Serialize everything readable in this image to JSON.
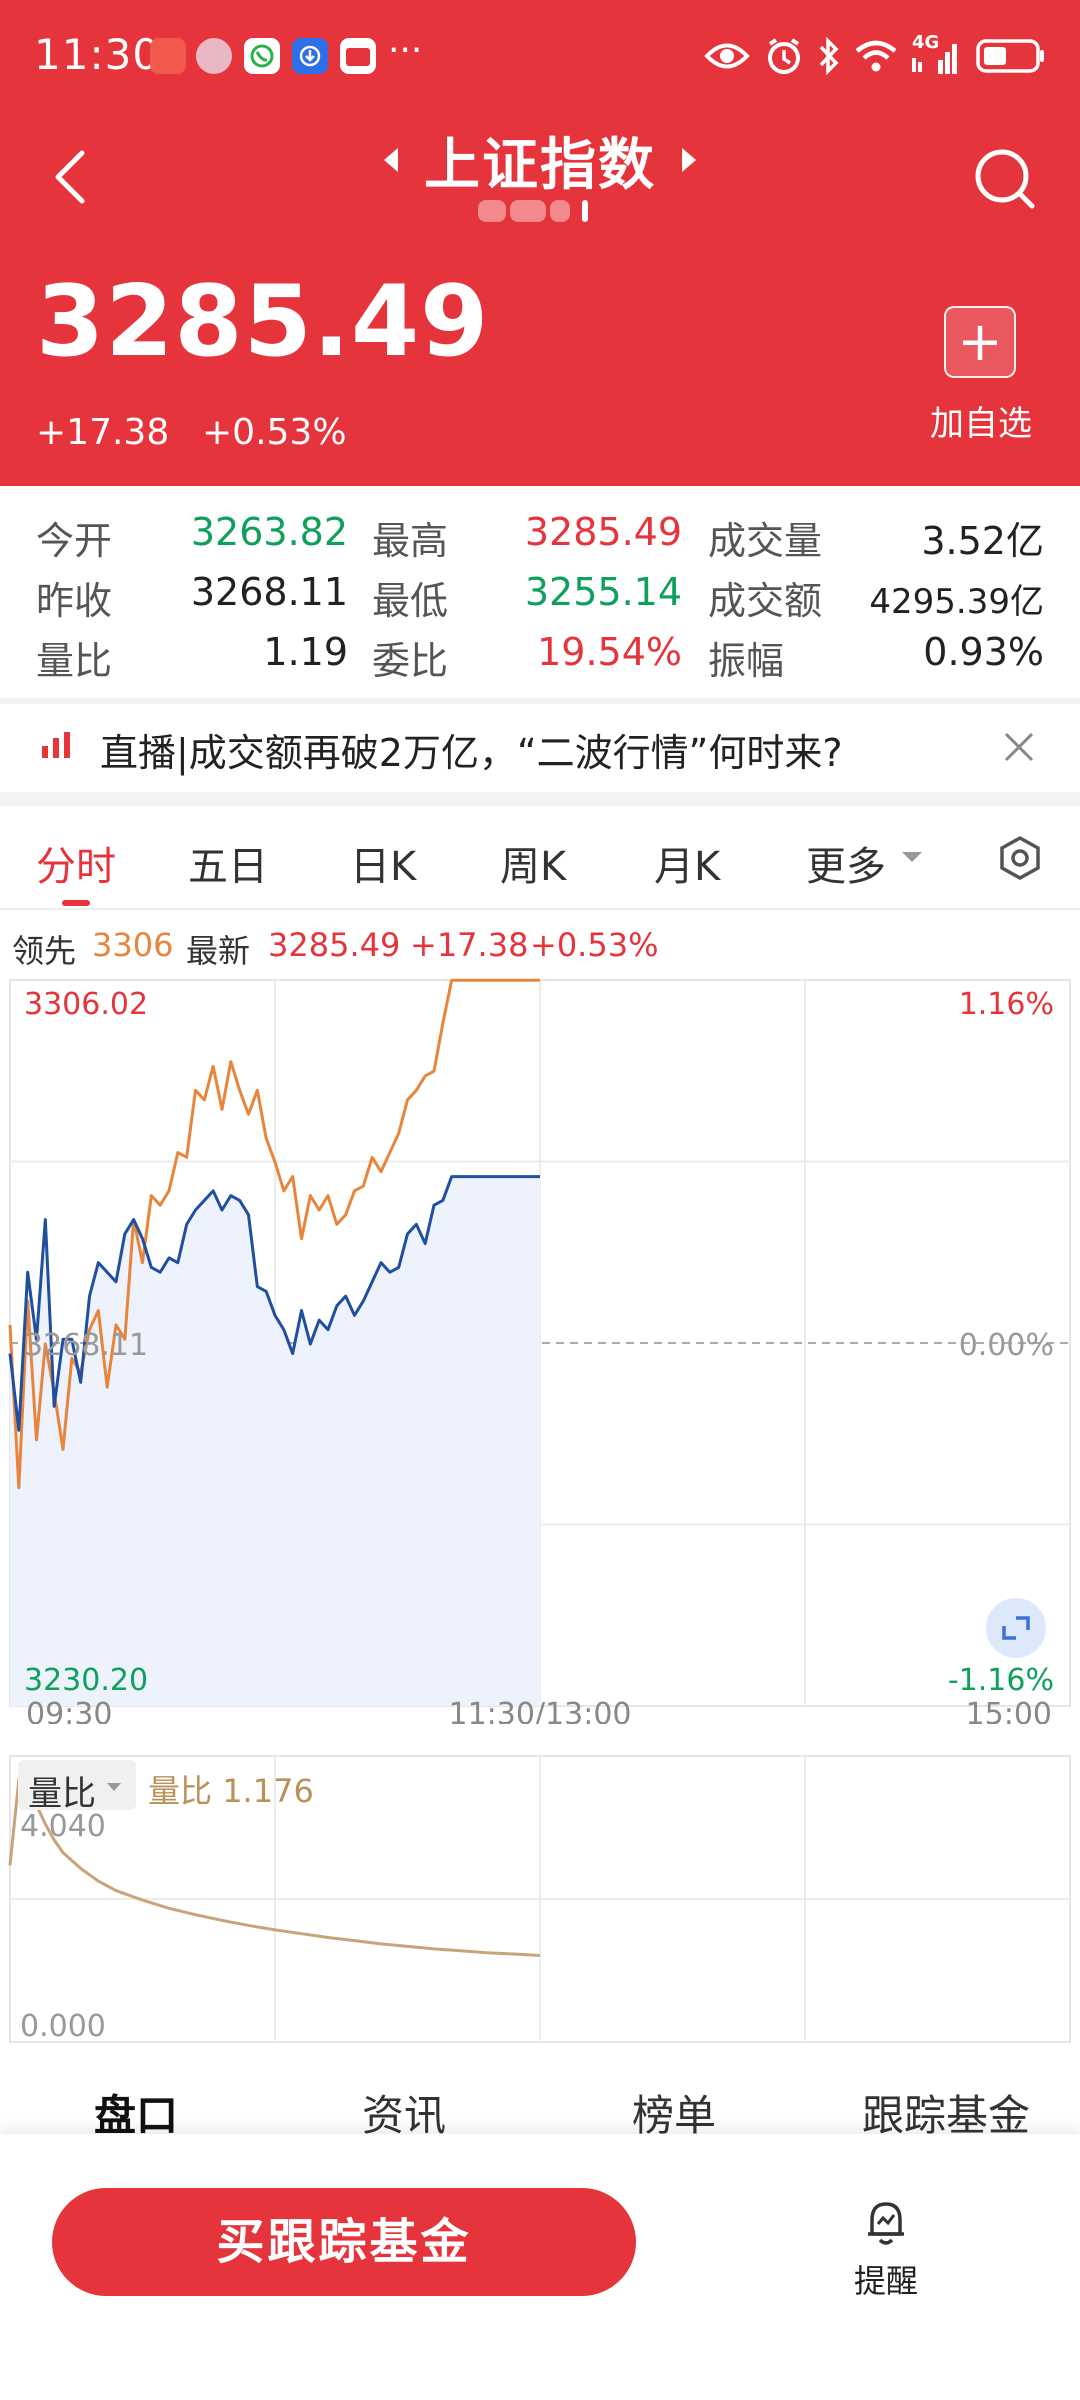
{
  "status_bar": {
    "time": "11:30",
    "more": "···",
    "icons": [
      "huawei-app-icon",
      "avatar-app-icon",
      "phone-app-icon",
      "download-app-icon",
      "shop-app-icon",
      "eye-icon",
      "alarm-icon",
      "bluetooth-icon",
      "wifi-icon",
      "signal-4g-icon",
      "battery-icon"
    ],
    "network": "4G"
  },
  "header": {
    "title": "上证指数",
    "price": "3285.49",
    "change": "+17.38",
    "change_pct": "+0.53%",
    "add_label": "加自选",
    "add_symbol": "+",
    "bg_color": "#e5343b"
  },
  "quote": {
    "rows": [
      [
        {
          "label": "今开",
          "value": "3263.82",
          "color": "green"
        },
        {
          "label": "最高",
          "value": "3285.49",
          "color": "red"
        },
        {
          "label": "成交量",
          "value": "3.52亿",
          "color": "black"
        }
      ],
      [
        {
          "label": "昨收",
          "value": "3268.11",
          "color": "black"
        },
        {
          "label": "最低",
          "value": "3255.14",
          "color": "green"
        },
        {
          "label": "成交额",
          "value": "4295.39亿",
          "color": "black"
        }
      ],
      [
        {
          "label": "量比",
          "value": "1.19",
          "color": "black"
        },
        {
          "label": "委比",
          "value": "19.54%",
          "color": "red"
        },
        {
          "label": "振幅",
          "value": "0.93%",
          "color": "black"
        }
      ]
    ]
  },
  "news": {
    "text": "直播|成交额再破2万亿，“二波行情”何时来?"
  },
  "tabs": {
    "items": [
      "分时",
      "五日",
      "日K",
      "周K",
      "月K",
      "更多"
    ],
    "active": 0
  },
  "legend": {
    "lead_label": "领先",
    "lead_value": "3306",
    "latest_label": "最新",
    "latest_value": "3285.49",
    "latest_change": "+17.38",
    "latest_pct": "+0.53%"
  },
  "chart_data": [
    {
      "type": "line",
      "title": "",
      "x_ticks": [
        "09:30",
        "11:30/13:00",
        "15:00"
      ],
      "y_left_ticks": [
        "3306.02",
        "3268.11",
        "3230.20"
      ],
      "y_right_ticks": [
        "1.16%",
        "0.00%",
        "-1.16%"
      ],
      "ylim": [
        3230.2,
        3306.02
      ],
      "reference": 3268.11,
      "colors": {
        "lead": "#e8853d",
        "latest": "#1f4f9e",
        "fill": "#eef2fd",
        "up": "#e5343b",
        "down": "#0fa05c"
      },
      "series": [
        {
          "name": "领先",
          "time_index": [
            0,
            2,
            4,
            6,
            8,
            10,
            12,
            14,
            16,
            18,
            20,
            22,
            24,
            26,
            28,
            30,
            32,
            34,
            36,
            38,
            40,
            42,
            44,
            46,
            48,
            50,
            52,
            54,
            56,
            58,
            60,
            62,
            64,
            66,
            68,
            70,
            72,
            74,
            76,
            78,
            80,
            82,
            84,
            86,
            88,
            90,
            92,
            94,
            96,
            98,
            100,
            102,
            104,
            106,
            108,
            110,
            112,
            114,
            116,
            118,
            120
          ],
          "values": [
            3270.0,
            3253.0,
            3272.5,
            3258.0,
            3268.0,
            3263.0,
            3257.0,
            3266.5,
            3265.0,
            3269.5,
            3271.5,
            3263.5,
            3270.0,
            3268.5,
            3281.0,
            3276.5,
            3283.5,
            3282.5,
            3284.0,
            3288.0,
            3287.5,
            3294.5,
            3293.5,
            3297.0,
            3292.5,
            3297.5,
            3294.5,
            3292.0,
            3294.5,
            3289.5,
            3287.0,
            3284.0,
            3285.5,
            3279.0,
            3283.5,
            3282.0,
            3283.5,
            3280.5,
            3281.5,
            3284.0,
            3284.5,
            3287.5,
            3286.0,
            3288.0,
            3290.0,
            3293.5,
            3294.5,
            3296.0,
            3296.5,
            3301.5,
            3306.0,
            3306.0,
            3306.0,
            3306.0,
            3306.0,
            3306.0,
            3306.0,
            3306.0,
            3306.0,
            3306.0,
            3306.0
          ]
        },
        {
          "name": "最新",
          "time_index": [
            0,
            2,
            4,
            6,
            8,
            10,
            12,
            14,
            16,
            18,
            20,
            22,
            24,
            26,
            28,
            30,
            32,
            34,
            36,
            38,
            40,
            42,
            44,
            46,
            48,
            50,
            52,
            54,
            56,
            58,
            60,
            62,
            64,
            66,
            68,
            70,
            72,
            74,
            76,
            78,
            80,
            82,
            84,
            86,
            88,
            90,
            92,
            94,
            96,
            98,
            100,
            102,
            104,
            106,
            108,
            110,
            112,
            114,
            116,
            118,
            120
          ],
          "values": [
            3267.0,
            3259.0,
            3275.5,
            3268.5,
            3281.0,
            3261.5,
            3268.5,
            3268.5,
            3264.0,
            3273.0,
            3276.5,
            3275.5,
            3274.5,
            3279.5,
            3281.0,
            3279.0,
            3276.0,
            3275.5,
            3277.0,
            3276.5,
            3280.5,
            3282.0,
            3283.0,
            3284.0,
            3282.0,
            3283.5,
            3283.0,
            3281.5,
            3274.0,
            3273.5,
            3271.0,
            3269.5,
            3267.0,
            3271.5,
            3268.0,
            3270.5,
            3269.5,
            3272.0,
            3273.0,
            3271.0,
            3272.5,
            3274.5,
            3276.5,
            3275.5,
            3276.0,
            3279.5,
            3280.5,
            3278.5,
            3282.5,
            3283.0,
            3285.49,
            3285.49,
            3285.49,
            3285.49,
            3285.49,
            3285.49,
            3285.49,
            3285.49,
            3285.49,
            3285.49,
            3285.49
          ]
        }
      ]
    },
    {
      "type": "line",
      "title": "",
      "series_label": "量比",
      "series_value": "1.176",
      "ylim": [
        0.0,
        4.04
      ],
      "y_ticks": [
        "4.040",
        "0.000"
      ],
      "color": "#c9a37a",
      "series": [
        {
          "name": "量比",
          "time_index": [
            0,
            2,
            4,
            6,
            8,
            10,
            12,
            16,
            20,
            24,
            30,
            36,
            42,
            48,
            54,
            60,
            66,
            72,
            78,
            84,
            90,
            96,
            102,
            108,
            114,
            120
          ],
          "values": [
            2.6,
            3.95,
            3.9,
            3.55,
            3.25,
            3.0,
            2.8,
            2.55,
            2.35,
            2.2,
            2.05,
            1.92,
            1.82,
            1.73,
            1.65,
            1.58,
            1.52,
            1.46,
            1.41,
            1.36,
            1.32,
            1.28,
            1.25,
            1.22,
            1.2,
            1.176
          ]
        }
      ]
    }
  ],
  "vol_label": {
    "label": "量比"
  },
  "bottom_tabs": {
    "items": [
      "盘口",
      "资讯",
      "榜单",
      "跟踪基金"
    ],
    "active": 0
  },
  "action_bar": {
    "buy_label": "买跟踪基金",
    "remind_label": "提醒"
  }
}
